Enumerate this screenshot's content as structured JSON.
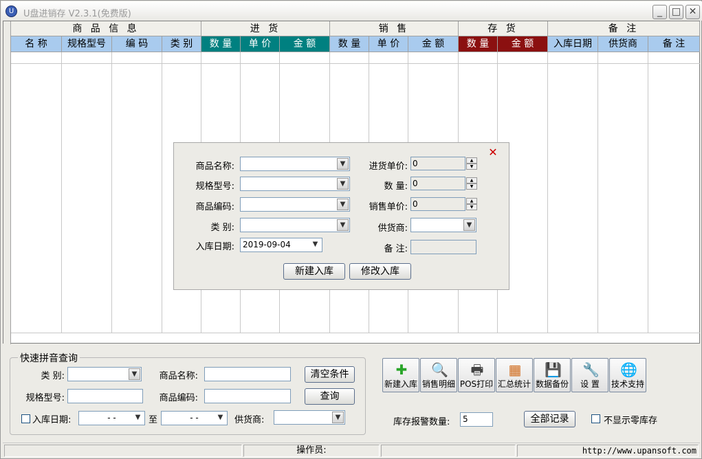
{
  "window": {
    "title": "U盘进销存 V2.3.1(免费版)",
    "minimize": "_",
    "maximize": "□",
    "close": "✕"
  },
  "groups": [
    "商 品 信 息",
    "进 货",
    "销 售",
    "存 货",
    "备 注"
  ],
  "columns": [
    "名 称",
    "规格型号",
    "编 码",
    "类 别",
    "数 量",
    "单 价",
    "金 额",
    "数 量",
    "单 价",
    "金 额",
    "数 量",
    "金 额",
    "入库日期",
    "供货商",
    "备 注"
  ],
  "dialog": {
    "close": "✕",
    "labels": {
      "name": "商品名称:",
      "spec": "规格型号:",
      "code": "商品编码:",
      "category": "类 别:",
      "date": "入库日期:",
      "in_price": "进货单价:",
      "qty": "数 量:",
      "sale_price": "销售单价:",
      "supplier": "供货商:",
      "remark": "备 注:"
    },
    "values": {
      "date": "2019-09-04",
      "in_price": "0",
      "qty": "0",
      "sale_price": "0"
    },
    "buttons": {
      "new": "新建入库",
      "edit": "修改入库"
    }
  },
  "query": {
    "legend": "快速拼音查询",
    "labels": {
      "category": "类 别:",
      "name": "商品名称:",
      "spec": "规格型号:",
      "code": "商品编码:",
      "date": "入库日期:",
      "to": "至",
      "supplier": "供货商:"
    },
    "date_placeholder": "-  -",
    "buttons": {
      "clear": "清空条件",
      "search": "查询"
    }
  },
  "toolbar": [
    {
      "label": "新建入库",
      "icon": "plus-icon",
      "glyph": "✚",
      "color": "#2aa52a"
    },
    {
      "label": "销售明细",
      "icon": "magnifier-icon",
      "glyph": "🔍",
      "color": "#3a6fb0"
    },
    {
      "label": "POS打印",
      "icon": "printer-icon",
      "glyph": "🖶",
      "color": "#444"
    },
    {
      "label": "汇总统计",
      "icon": "calendar-icon",
      "glyph": "▦",
      "color": "#d06a1a"
    },
    {
      "label": "数据备份",
      "icon": "floppy-icon",
      "glyph": "💾",
      "color": "#8a5aa8"
    },
    {
      "label": "设 置",
      "icon": "wrench-icon",
      "glyph": "🔧",
      "color": "#c96a10"
    },
    {
      "label": "技术支持",
      "icon": "globe-icon",
      "glyph": "🌐",
      "color": "#2b7ac8"
    }
  ],
  "alarm": {
    "label": "库存报警数量:",
    "value": "5"
  },
  "all_records": "全部记录",
  "hide_zero": "不显示零库存",
  "status": {
    "operator": "操作员:",
    "url": "http://www.upansoft.com"
  }
}
